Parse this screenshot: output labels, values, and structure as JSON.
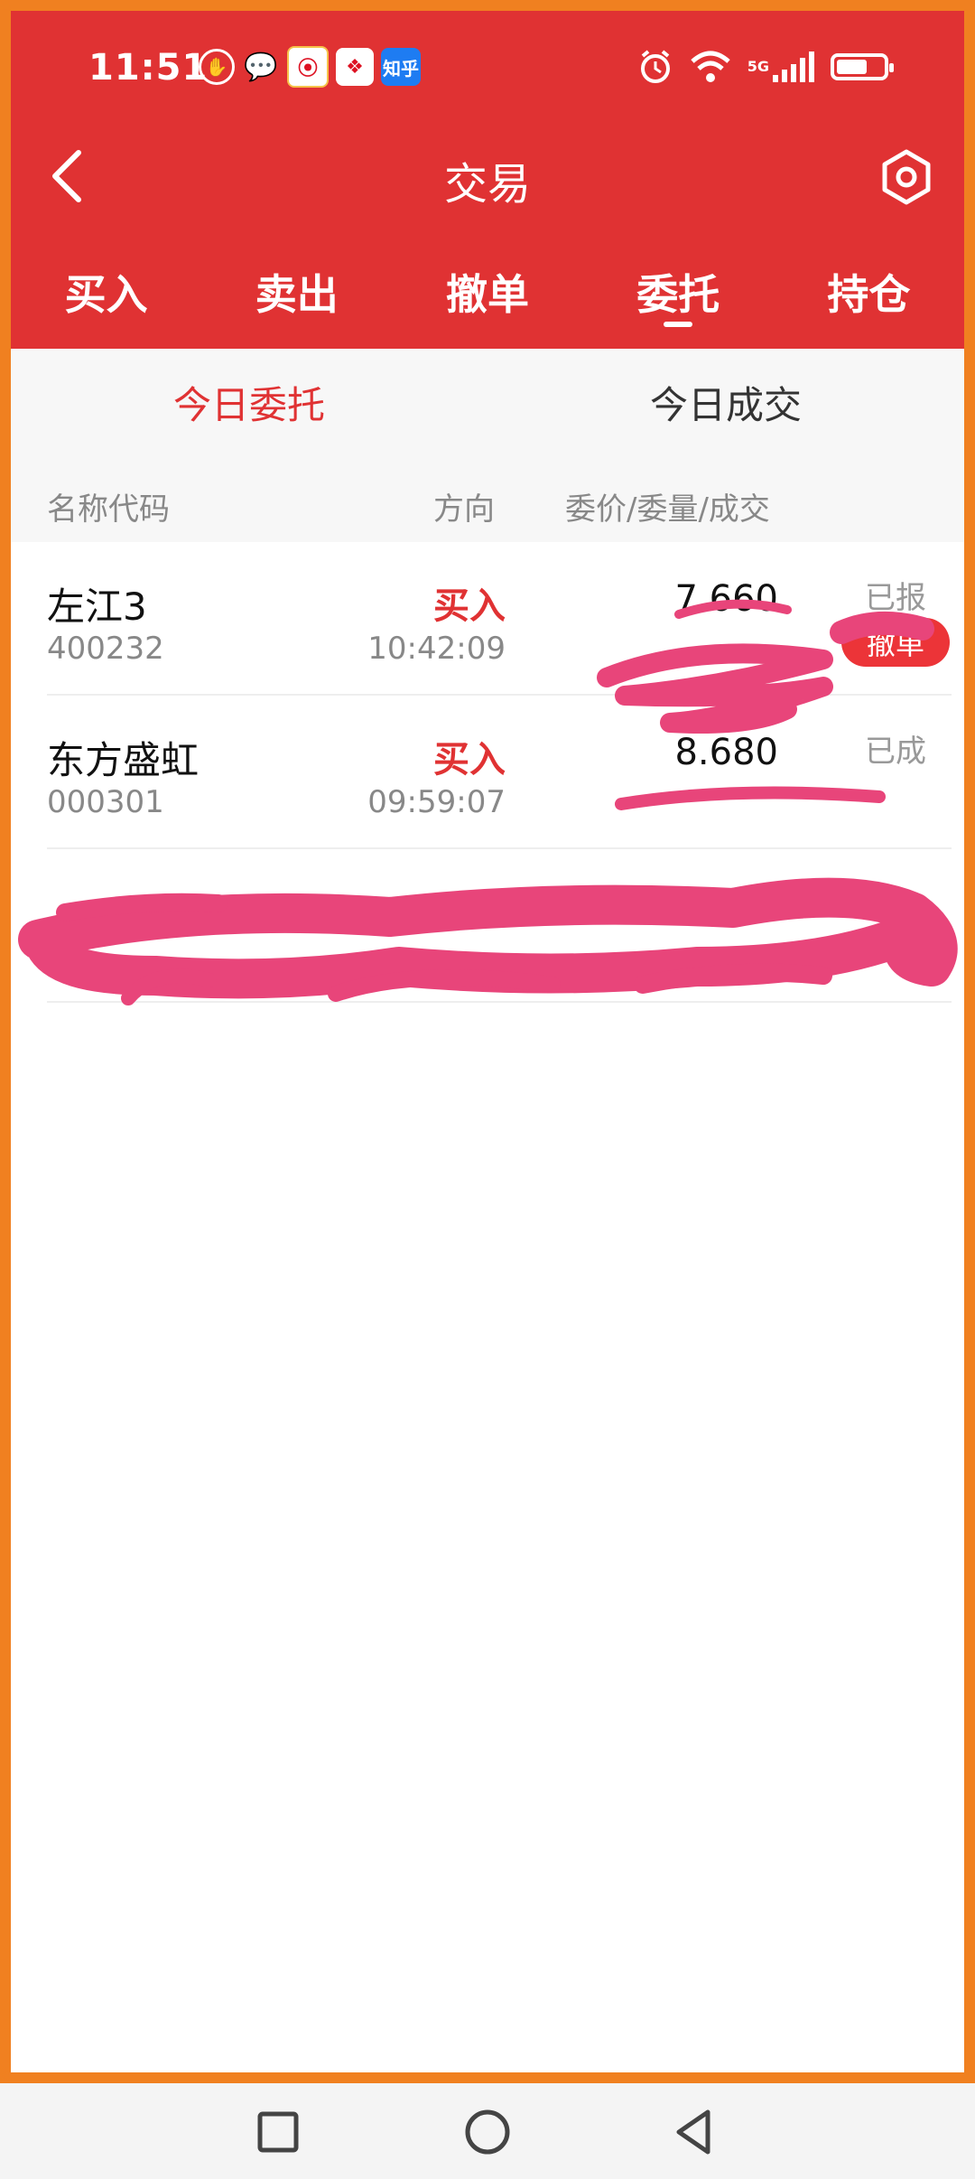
{
  "status_bar": {
    "time": "11:51",
    "network": "5G",
    "notif_zhihu": "知乎",
    "battery_level": 0.65
  },
  "title_bar": {
    "title": "交易"
  },
  "trade_tabs": [
    "买入",
    "卖出",
    "撤单",
    "委托",
    "持仓"
  ],
  "active_trade_tab": "委托",
  "subtabs": [
    "今日委托",
    "今日成交"
  ],
  "active_subtab": "今日委托",
  "columns": {
    "name_code": "名称代码",
    "direction": "方向",
    "price_qty_deal": "委价/委量/成交"
  },
  "orders": [
    {
      "name": "左江3",
      "code": "400232",
      "direction": "买入",
      "time": "10:42:09",
      "price": "7.660",
      "status": "已报",
      "action": "撤单"
    },
    {
      "name": "东方盛虹",
      "code": "000301",
      "direction": "买入",
      "time": "09:59:07",
      "price": "8.680",
      "status": "已成"
    }
  ],
  "colors": {
    "brand_red": "#e03233",
    "frame_orange": "#f08020",
    "redaction_pink": "#e8457a"
  },
  "icons": {
    "back": "chevron-left-icon",
    "settings": "hexagon-settings-icon",
    "nav_recent": "square-icon",
    "nav_home": "circle-icon",
    "nav_back": "triangle-back-icon"
  }
}
